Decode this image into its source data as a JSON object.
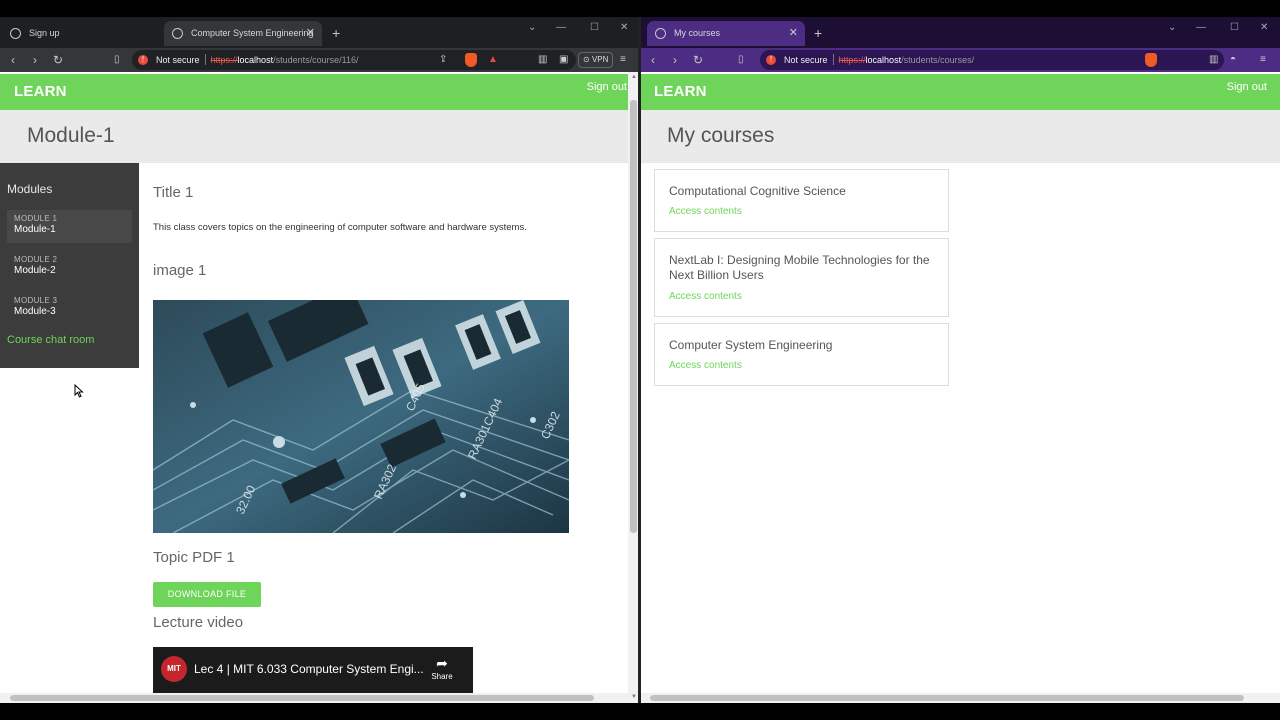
{
  "left_window": {
    "tabs": [
      {
        "title": "Sign up",
        "active": false
      },
      {
        "title": "Computer System Engineering",
        "active": true
      }
    ],
    "url": {
      "security": "Not secure",
      "scheme": "https://",
      "host": "localhost",
      "path": "/students/course/116/"
    },
    "vpn_label": "VPN",
    "brand": "LEARN",
    "sign_out": "Sign out",
    "page_title": "Module-1",
    "sidebar": {
      "title": "Modules",
      "modules": [
        {
          "small": "MODULE 1",
          "name": "Module-1",
          "selected": true
        },
        {
          "small": "MODULE 2",
          "name": "Module-2",
          "selected": false
        },
        {
          "small": "MODULE 3",
          "name": "Module-3",
          "selected": false
        }
      ],
      "chat_link": "Course chat room"
    },
    "content": {
      "title": "Title 1",
      "text": "This class covers topics on the engineering of computer software and hardware systems.",
      "image_heading": "image 1",
      "pdf_heading": "Topic PDF 1",
      "download_label": "DOWNLOAD FILE",
      "video_heading": "Lecture video",
      "video": {
        "channel_logo": "MIT",
        "title": "Lec 4 | MIT 6.033 Computer System Engi...",
        "share_label": "Share"
      }
    }
  },
  "right_window": {
    "tabs": [
      {
        "title": "My courses",
        "active": true
      }
    ],
    "url": {
      "security": "Not secure",
      "scheme": "https://",
      "host": "localhost",
      "path": "/students/courses/"
    },
    "brand": "LEARN",
    "sign_out": "Sign out",
    "page_title": "My courses",
    "courses": [
      {
        "title": "Computational Cognitive Science",
        "link": "Access contents"
      },
      {
        "title": "NextLab I: Designing Mobile Technologies for the Next Billion Users",
        "link": "Access contents"
      },
      {
        "title": "Computer System Engineering",
        "link": "Access contents"
      }
    ]
  },
  "colors": {
    "brand_green": "#6fd45a",
    "sidebar_dark": "#3c3c3c",
    "left_chrome": "#35363a",
    "right_chrome": "#4d2d84"
  }
}
